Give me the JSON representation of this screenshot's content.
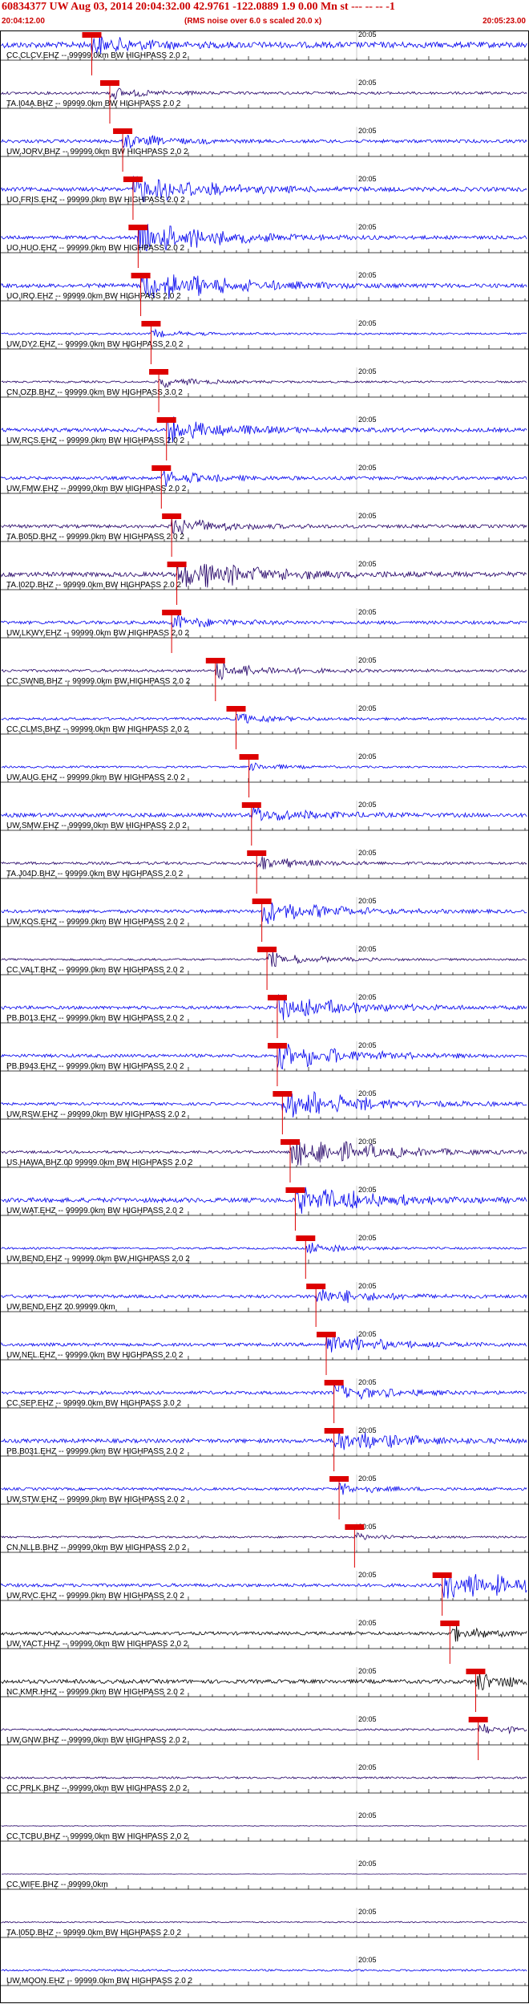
{
  "header": {
    "title": "60834377 UW Aug 03, 2014 20:04:32.00   42.9761 -122.0889  1.9 0.00 Mn st --- -- --  -1",
    "start_time": "20:04:12.00",
    "note": "(RMS noise over 6.0 s scaled 20.0 x)",
    "end_time": "20:05:23.00"
  },
  "chart_data": {
    "type": "line",
    "tick_label": "20:05",
    "colors": {
      "blue": "#0000ee",
      "dark": "#220066",
      "black": "#000000",
      "pick": "#dd0000"
    },
    "traces": [
      {
        "label": "CC.CLCV.EHZ -- 99999.0km BW  HIGHPASS  2.0  2",
        "color": "blue",
        "amp": 0.9,
        "pick": 0.35,
        "burst": 0.5
      },
      {
        "label": "TA.I04A.BHZ -- 99999.0km BW  HIGHPASS  2.0  2",
        "color": "dark",
        "amp": 0.4,
        "pick": 0.42,
        "burst": 0.3
      },
      {
        "label": "UW.JORV.BHZ -- 99999.0km BW  HIGHPASS  2.0  2",
        "color": "blue",
        "amp": 0.5,
        "pick": 0.47,
        "burst": 0.4
      },
      {
        "label": "UO.FRIS.EHZ -- 99999.0km BW  HIGHPASS  2.0  2",
        "color": "blue",
        "amp": 0.6,
        "pick": 0.51,
        "burst": 0.9
      },
      {
        "label": "UO.HUO.EHZ -- 99999.0km BW  HIGHPASS  2.0  2",
        "color": "blue",
        "amp": 0.5,
        "pick": 0.53,
        "burst": 1.0
      },
      {
        "label": "UO.IRO.EHZ -- 99999.0km BW  HIGHPASS  2.0  2",
        "color": "blue",
        "amp": 0.6,
        "pick": 0.54,
        "burst": 1.0
      },
      {
        "label": "UW.DY2.EHZ -- 99999.0km BW  HIGHPASS  2.0  2",
        "color": "blue",
        "amp": 0.3,
        "pick": 0.58,
        "burst": 0.2
      },
      {
        "label": "CN.OZB.BHZ -- 99999.0km BW  HIGHPASS  3.0  2",
        "color": "dark",
        "amp": 0.3,
        "pick": 0.61,
        "burst": 0.3
      },
      {
        "label": "UW.RCS.EHZ -- 99999.0km BW  HIGHPASS  2.0  2",
        "color": "blue",
        "amp": 0.6,
        "pick": 0.64,
        "burst": 0.7
      },
      {
        "label": "UW.FMW.EHZ -- 99999.0km BW  HIGHPASS  2.0  2",
        "color": "blue",
        "amp": 0.5,
        "pick": 0.62,
        "burst": 0.4
      },
      {
        "label": "TA.B05D.BHZ -- 99999.0km BW  HIGHPASS  2.0  2",
        "color": "dark",
        "amp": 0.5,
        "pick": 0.66,
        "burst": 0.5
      },
      {
        "label": "TA.I02D.BHZ -- 99999.0km BW  HIGHPASS  2.0  2",
        "color": "dark",
        "amp": 0.7,
        "pick": 0.68,
        "burst": 1.0
      },
      {
        "label": "UW.LKWY.EHZ -- 99999.0km BW  HIGHPASS  2.0  2",
        "color": "blue",
        "amp": 0.5,
        "pick": 0.66,
        "burst": 0.4
      },
      {
        "label": "CC.SWNB.BHZ -- 99999.0km BW  HIGHPASS  2.0  2",
        "color": "dark",
        "amp": 0.4,
        "pick": 0.83,
        "burst": 0.5
      },
      {
        "label": "CC.CLMS.BHZ -- 99999.0km BW  HIGHPASS  2.0  2",
        "color": "blue",
        "amp": 0.4,
        "pick": 0.91,
        "burst": 0.3
      },
      {
        "label": "UW.AUG.EHZ -- 99999.0km BW  HIGHPASS  2.0  2",
        "color": "blue",
        "amp": 0.3,
        "pick": 0.96,
        "burst": 0.2
      },
      {
        "label": "UW.SMW.EHZ -- 99999.0km BW  HIGHPASS  2.0  2",
        "color": "blue",
        "amp": 0.6,
        "pick": 0.97,
        "burst": 0.5
      },
      {
        "label": "TA.J04D.BHZ -- 99999.0km BW  HIGHPASS  2.0  2",
        "color": "dark",
        "amp": 0.4,
        "pick": 0.99,
        "burst": 0.4
      },
      {
        "label": "UW.KOS.EHZ -- 99999.0km BW  HIGHPASS  2.0  2",
        "color": "blue",
        "amp": 0.5,
        "pick": 1.01,
        "burst": 0.7
      },
      {
        "label": "CC.VALT.BHZ -- 99999.0km BW  HIGHPASS  2.0  2",
        "color": "dark",
        "amp": 0.3,
        "pick": 1.03,
        "burst": 0.4
      },
      {
        "label": "PB.B013.EHZ -- 99999.0km BW  HIGHPASS  2.0  2",
        "color": "blue",
        "amp": 0.5,
        "pick": 1.07,
        "burst": 0.8
      },
      {
        "label": "PB.B943.EHZ -- 99999.0km BW  HIGHPASS  2.0  2",
        "color": "blue",
        "amp": 0.5,
        "pick": 1.07,
        "burst": 0.8
      },
      {
        "label": "UW.RSW.EHZ -- 99999.0km BW  HIGHPASS  2.0  2",
        "color": "blue",
        "amp": 0.4,
        "pick": 1.09,
        "burst": 1.0
      },
      {
        "label": "US.HAWA.BHZ.00 99999.0km BW  HIGHPASS  2.0  2",
        "color": "dark",
        "amp": 0.4,
        "pick": 1.12,
        "burst": 1.0
      },
      {
        "label": "UW.WAT.EHZ -- 99999.0km BW  HIGHPASS  2.0  2",
        "color": "blue",
        "amp": 0.7,
        "pick": 1.14,
        "burst": 0.9
      },
      {
        "label": "UW.BEND.EHZ -- 99999.0km BW  HIGHPASS  2.0  2",
        "color": "blue",
        "amp": 0.3,
        "pick": 1.18,
        "burst": 0.3
      },
      {
        "label": "UW.BEND.EHZ 20.99999.0km",
        "color": "blue",
        "amp": 0.5,
        "pick": 1.22,
        "burst": 0.5
      },
      {
        "label": "UW.NEL.EHZ -- 99999.0km BW  HIGHPASS  2.0  2",
        "color": "blue",
        "amp": 0.5,
        "pick": 1.26,
        "burst": 0.6
      },
      {
        "label": "CC.SEP.EHZ -- 99999.0km BW  HIGHPASS  3.0  2",
        "color": "blue",
        "amp": 0.5,
        "pick": 1.29,
        "burst": 0.5
      },
      {
        "label": "PB.B031.EHZ -- 99999.0km BW  HIGHPASS  2.0  2",
        "color": "blue",
        "amp": 0.6,
        "pick": 1.29,
        "burst": 0.7
      },
      {
        "label": "UW.STW.EHZ -- 99999.0km BW  HIGHPASS  2.0  2",
        "color": "blue",
        "amp": 0.4,
        "pick": 1.31,
        "burst": 0.3
      },
      {
        "label": "CN.NLLB.BHZ -- 99999.0km BW  HIGHPASS  2.0  2",
        "color": "dark",
        "amp": 0.3,
        "pick": 1.37,
        "burst": 0.2
      },
      {
        "label": "UW.RVC.EHZ -- 99999.0km BW  HIGHPASS  2.0  2",
        "color": "blue",
        "amp": 0.5,
        "pick": 1.71,
        "burst": 1.0
      },
      {
        "label": "UW.YACT.HHZ -- 99999.0km BW  HIGHPASS  2.0  2",
        "color": "black",
        "amp": 0.5,
        "pick": 1.74,
        "burst": 0.4
      },
      {
        "label": "NC.KMR.HHZ -- 99999.0km BW  HIGHPASS  2.0  2",
        "color": "black",
        "amp": 0.6,
        "pick": 1.84,
        "burst": 0.5
      },
      {
        "label": "UW.GNW.BHZ -- 99999.0km BW  HIGHPASS  2.0  2",
        "color": "dark",
        "amp": 0.3,
        "pick": 1.85,
        "burst": 0.3
      },
      {
        "label": "CC.PRLK.BHZ -- 99999.0km BW  HIGHPASS  2.0  2",
        "color": "dark",
        "amp": 0.3,
        "pick": null,
        "burst": 0.2
      },
      {
        "label": "CC.TCBU.BHZ -- 99999.0km BW  HIGHPASS  2.0  2",
        "color": "dark",
        "amp": 0.1,
        "pick": null,
        "burst": 0.0
      },
      {
        "label": "CC.WIFE.BHZ -- 99999.0km",
        "color": "dark",
        "amp": 0.05,
        "pick": null,
        "burst": 0.0
      },
      {
        "label": "TA.I05D.BHZ -- 99999.0km BW  HIGHPASS  2.0  2",
        "color": "dark",
        "amp": 0.2,
        "pick": null,
        "burst": 0.0
      },
      {
        "label": "UW.MOON.EHZ -- 99999.0km BW  HIGHPASS  2.0  2",
        "color": "blue",
        "amp": 0.3,
        "pick": null,
        "burst": 0.1
      }
    ]
  }
}
